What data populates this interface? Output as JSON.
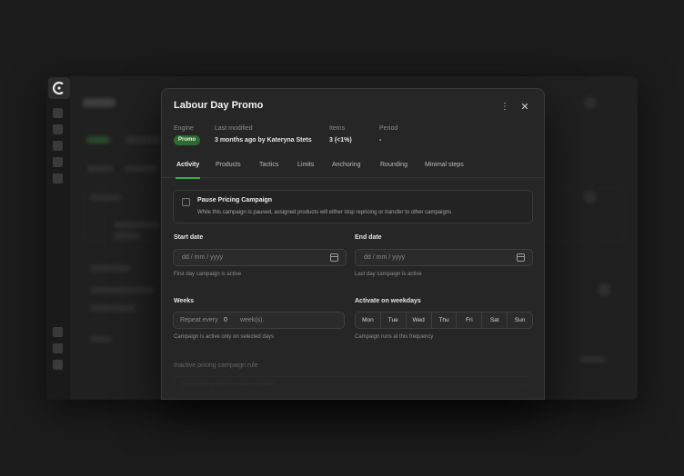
{
  "modal": {
    "title": "Labour Day Promo",
    "meta": {
      "engine_label": "Engine",
      "engine_value": "Promo",
      "last_modified_label": "Last modified",
      "last_modified_value": "3 months ago by Kateryna Stets",
      "items_label": "Items",
      "items_value": "3 (<1%)",
      "period_label": "Period",
      "period_value": "-"
    },
    "tabs": [
      "Activity",
      "Products",
      "Tactics",
      "Limits",
      "Anchoring",
      "Rounding",
      "Minimal steps"
    ],
    "active_tab": "Activity",
    "pause": {
      "title": "Pause Pricing Campaign",
      "description": "While this campaign is paused, assigned products will either stop repricing or transfer to other campaigns"
    },
    "start_date": {
      "label": "Start date",
      "placeholder": "dd / mm / yyyy",
      "helper": "First day campaign is active"
    },
    "end_date": {
      "label": "End date",
      "placeholder": "dd / mm / yyyy",
      "helper": "Last day campaign is active"
    },
    "weeks": {
      "label": "Weeks",
      "prefix": "Repeat every",
      "value": "0",
      "suffix": "week(s).",
      "helper": "Campaign is active only on selected days"
    },
    "weekdays": {
      "label": "Activate on weekdays",
      "days": [
        "Mon",
        "Tue",
        "Wed",
        "Thu",
        "Fri",
        "Sat",
        "Sun"
      ],
      "helper": "Campaign runs at this frequency"
    },
    "inactive_rule": {
      "label": "Inactive pricing campaign rule",
      "placeholder": "Unassign products while inactive"
    }
  },
  "icons": {
    "more": "more-vertical-icon",
    "close": "close-icon",
    "calendar": "calendar-icon",
    "logo": "app-logo-icon"
  },
  "colors": {
    "accent": "#3faa45",
    "badge_bg": "#2c6b30",
    "modal_bg": "#262626",
    "page_bg": "#1c1c1c"
  }
}
